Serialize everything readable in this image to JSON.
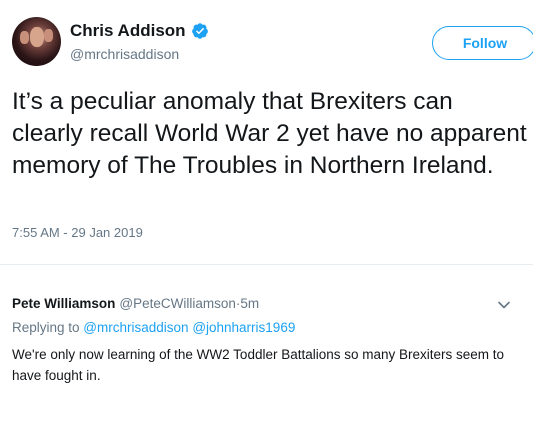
{
  "tweet": {
    "author_name": "Chris Addison",
    "author_handle": "@mrchrisaddison",
    "follow_label": "Follow",
    "text": "It’s a peculiar anomaly that Brexiters can clearly recall World War 2 yet have no apparent memory of The Troubles in Northern Ireland.",
    "timestamp": "7:55 AM - 29 Jan 2019"
  },
  "reply": {
    "author_name": "Pete Williamson",
    "author_handle": "@PeteCWilliamson",
    "separator": " · ",
    "time": "5m",
    "replying_prefix": "Replying to ",
    "mention_1": "@mrchrisaddison",
    "mention_2": "@johnharris1969",
    "text": "We're only now learning of the WW2 Toddler Battalions so many Brexiters seem to have fought in."
  },
  "colors": {
    "accent": "#1da1f2",
    "text": "#14171a",
    "muted": "#657786",
    "divider": "#e6ecf0"
  },
  "icons": {
    "verified": "verified-badge-icon",
    "menu": "chevron-down-icon"
  }
}
